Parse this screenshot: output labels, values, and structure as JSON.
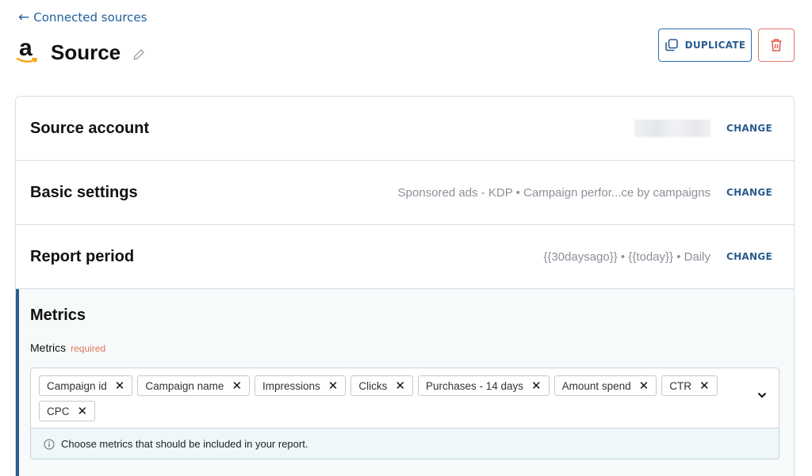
{
  "nav": {
    "back_arrow": "←",
    "back_label": "Connected sources"
  },
  "header": {
    "logo_letter": "a",
    "logo_icon": "amazon-logo",
    "title": "Source",
    "edit_icon": "pencil-icon"
  },
  "actions": {
    "duplicate_label": "DUPLICATE",
    "duplicate_icon": "copy-icon",
    "delete_icon": "trash-icon",
    "accent_color": "#2b5c8f",
    "danger_color": "#e07a6b"
  },
  "sections": [
    {
      "label": "Source account",
      "summary": "",
      "change_label": "CHANGE"
    },
    {
      "label": "Basic settings",
      "summary": "Sponsored ads - KDP • Campaign perfor...ce by campaigns",
      "change_label": "CHANGE"
    },
    {
      "label": "Report period",
      "summary": "{{30daysago}} • {{today}} • Daily",
      "change_label": "CHANGE"
    }
  ],
  "metrics": {
    "title": "Metrics",
    "field_label": "Metrics",
    "required_label": "required",
    "chips": [
      "Campaign id",
      "Campaign name",
      "Impressions",
      "Clicks",
      "Purchases - 14 days",
      "Amount spend",
      "CTR",
      "CPC"
    ],
    "remove_glyph": "✕",
    "hint": "Choose metrics that should be included in your report."
  }
}
